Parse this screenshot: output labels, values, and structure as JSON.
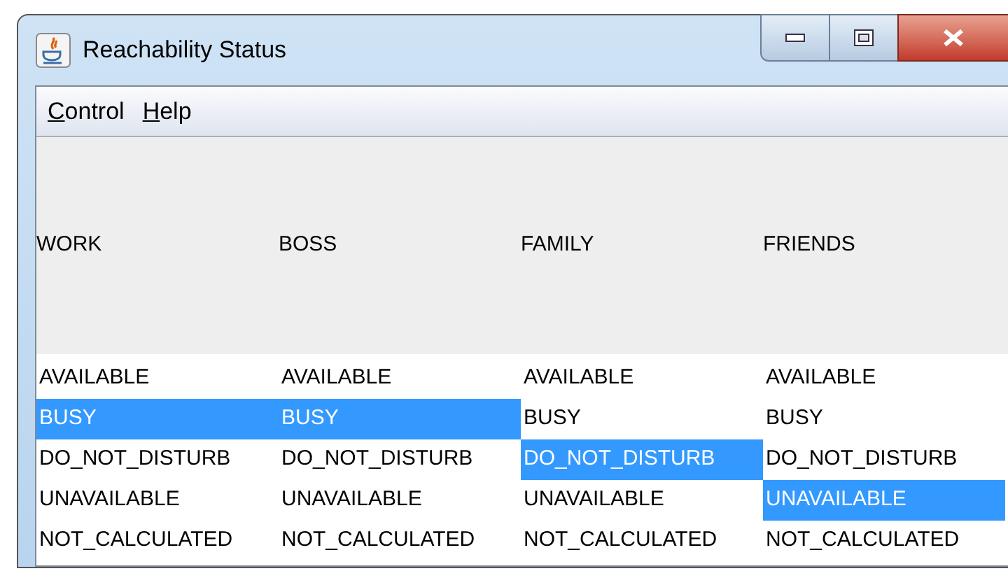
{
  "window": {
    "title": "Reachability Status"
  },
  "menu": [
    {
      "label": "Control",
      "first_letter_underlined": true
    },
    {
      "label": "Help",
      "first_letter_underlined": true
    }
  ],
  "columns": [
    {
      "header": "WORK",
      "items": [
        {
          "label": "AVAILABLE",
          "selected": false
        },
        {
          "label": "BUSY",
          "selected": true
        },
        {
          "label": "DO_NOT_DISTURB",
          "selected": false
        },
        {
          "label": "UNAVAILABLE",
          "selected": false
        },
        {
          "label": "NOT_CALCULATED",
          "selected": false
        }
      ]
    },
    {
      "header": "BOSS",
      "items": [
        {
          "label": "AVAILABLE",
          "selected": false
        },
        {
          "label": "BUSY",
          "selected": true
        },
        {
          "label": "DO_NOT_DISTURB",
          "selected": false
        },
        {
          "label": "UNAVAILABLE",
          "selected": false
        },
        {
          "label": "NOT_CALCULATED",
          "selected": false
        }
      ]
    },
    {
      "header": "FAMILY",
      "items": [
        {
          "label": "AVAILABLE",
          "selected": false
        },
        {
          "label": "BUSY",
          "selected": false
        },
        {
          "label": "DO_NOT_DISTURB",
          "selected": true
        },
        {
          "label": "UNAVAILABLE",
          "selected": false
        },
        {
          "label": "NOT_CALCULATED",
          "selected": false
        }
      ]
    },
    {
      "header": "FRIENDS",
      "items": [
        {
          "label": "AVAILABLE",
          "selected": false
        },
        {
          "label": "BUSY",
          "selected": false
        },
        {
          "label": "DO_NOT_DISTURB",
          "selected": false
        },
        {
          "label": "UNAVAILABLE",
          "selected": true
        },
        {
          "label": "NOT_CALCULATED",
          "selected": false
        }
      ]
    }
  ]
}
